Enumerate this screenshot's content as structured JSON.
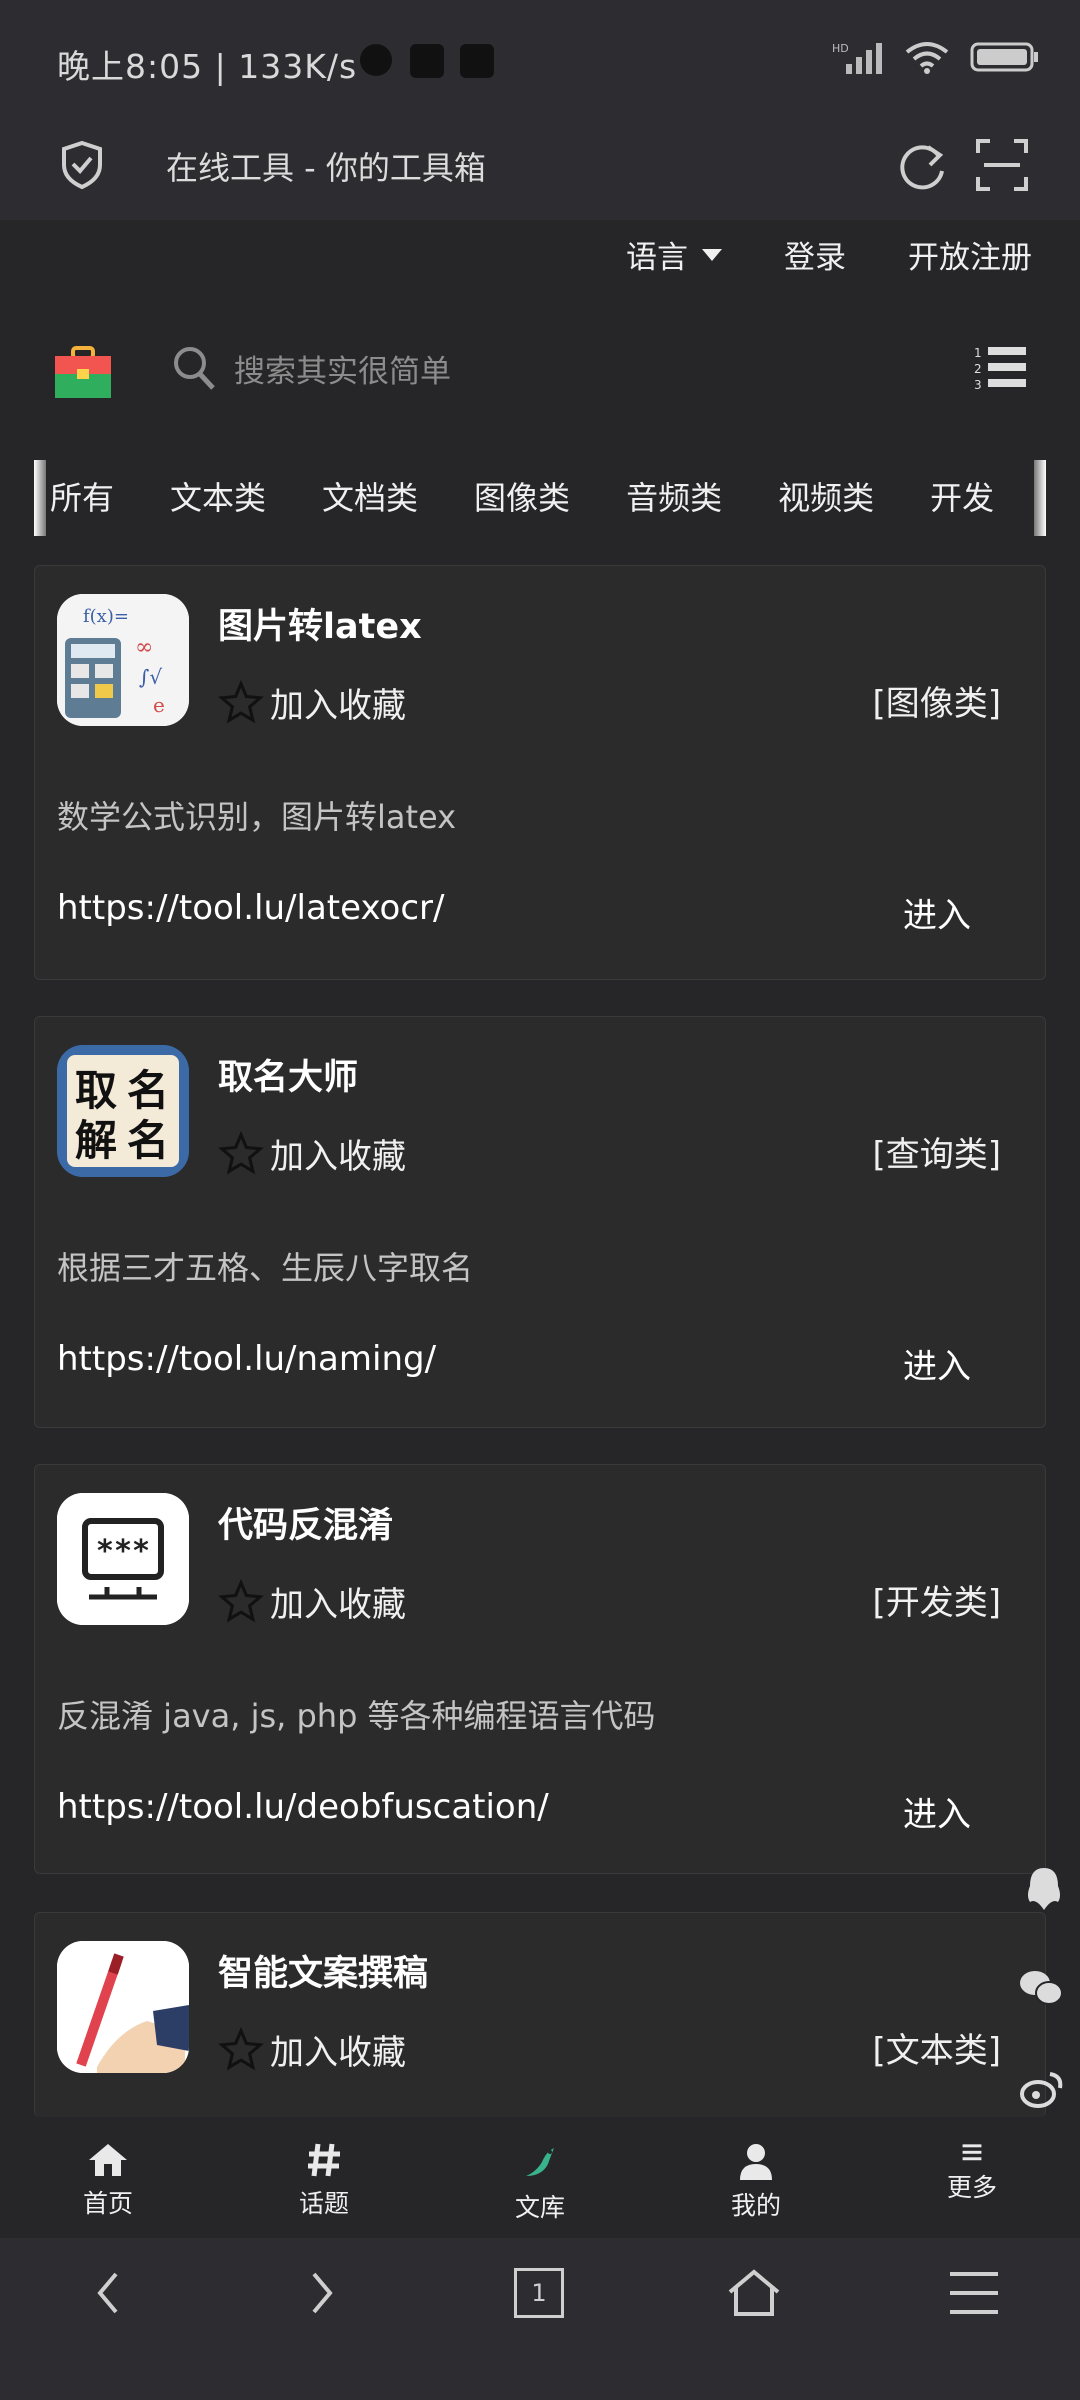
{
  "status_bar": {
    "time": "晚上8:05 | 133K/s"
  },
  "browser": {
    "title": "在线工具 - 你的工具箱"
  },
  "top_links": {
    "language": "语言",
    "login": "登录",
    "register": "开放注册"
  },
  "search": {
    "placeholder": "搜索其实很简单"
  },
  "tabs": [
    "所有",
    "文本类",
    "文档类",
    "图像类",
    "音频类",
    "视频类",
    "开发"
  ],
  "cards": [
    {
      "title": "图片转latex",
      "fav": "加入收藏",
      "category": "[图像类]",
      "desc": "数学公式识别，图片转latex",
      "url": "https://tool.lu/latexocr/",
      "enter": "进入"
    },
    {
      "title": "取名大师",
      "fav": "加入收藏",
      "category": "[查询类]",
      "desc": "根据三才五格、生辰八字取名",
      "url": "https://tool.lu/naming/",
      "enter": "进入",
      "icon_text": [
        "取",
        "名",
        "解",
        "名"
      ]
    },
    {
      "title": "代码反混淆",
      "fav": "加入收藏",
      "category": "[开发类]",
      "desc": "反混淆 java, js, php 等各种编程语言代码",
      "url": "https://tool.lu/deobfuscation/",
      "enter": "进入",
      "icon_text": "***"
    },
    {
      "title": "智能文案撰稿",
      "fav": "加入收藏",
      "category": "[文本类]"
    }
  ],
  "bottom_nav": [
    "首页",
    "话题",
    "文库",
    "我的",
    "更多"
  ],
  "system_nav": {
    "tab_count": "1"
  },
  "colors": {
    "background": "#262628",
    "card": "#2b2b2b",
    "active_nav": "#39b48a"
  }
}
